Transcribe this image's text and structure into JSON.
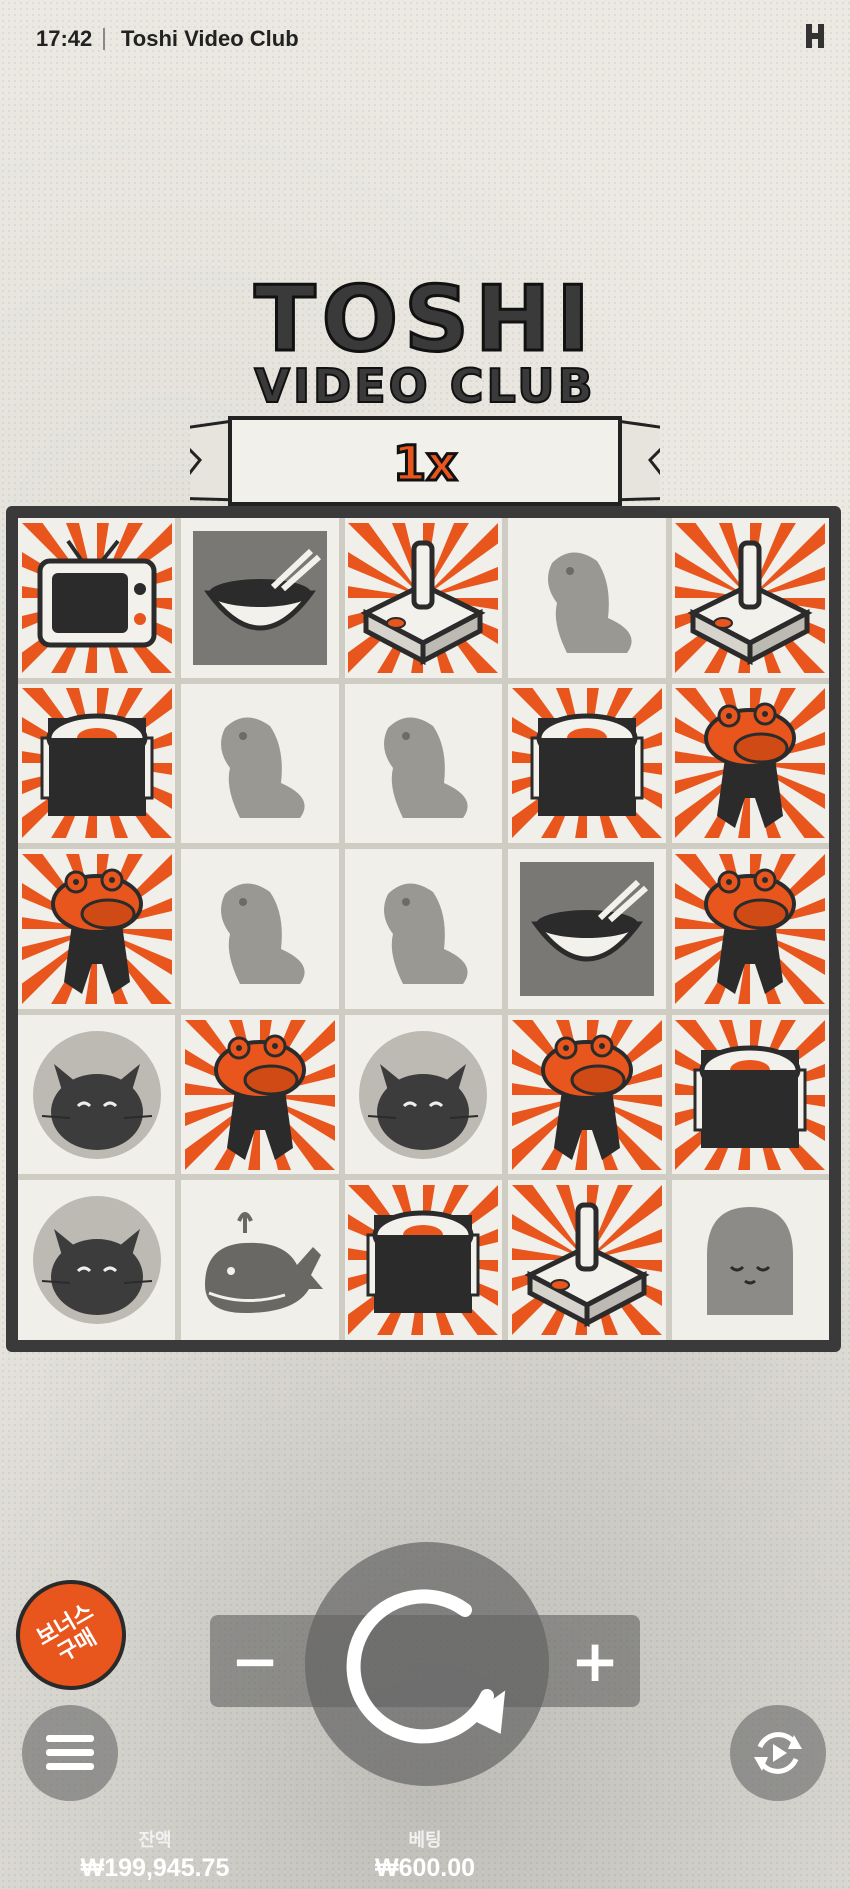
{
  "status_bar": {
    "time": "17:42",
    "title": "Toshi Video Club"
  },
  "logo": {
    "line1": "TOSHI",
    "line2": "VIDEO CLUB",
    "multiplier": "1x"
  },
  "reels": [
    [
      "tv",
      "bowl",
      "joystick",
      "beaver",
      "joystick"
    ],
    [
      "sushi",
      "beaver",
      "beaver",
      "sushi",
      "frog"
    ],
    [
      "frog",
      "beaver",
      "beaver",
      "bowl",
      "frog"
    ],
    [
      "cat",
      "frog",
      "cat",
      "frog",
      "sushi"
    ],
    [
      "cat",
      "whale",
      "sushi",
      "joystick",
      "ghost"
    ]
  ],
  "controls": {
    "bonus_buy_line1": "보너스",
    "bonus_buy_line2": "구매",
    "minus": "−",
    "plus": "+"
  },
  "balance": {
    "label": "잔액",
    "value": "₩199,945.75"
  },
  "bet": {
    "label": "베팅",
    "value": "₩600.00"
  },
  "colors": {
    "accent": "#e8561e",
    "dark": "#2a2a2a",
    "muted": "#9a9893"
  }
}
